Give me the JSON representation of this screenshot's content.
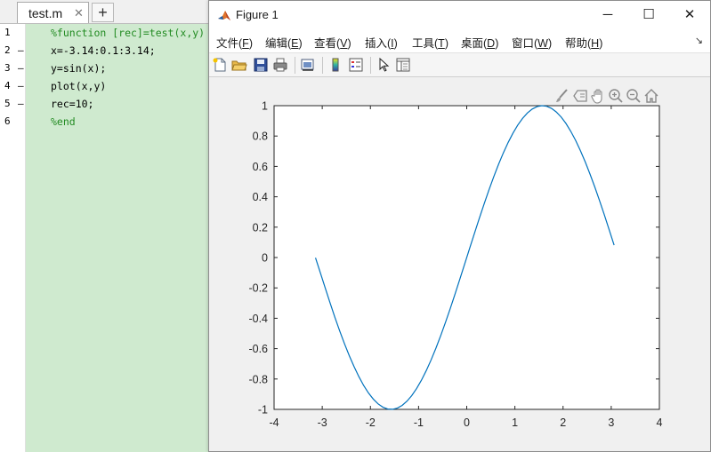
{
  "editor": {
    "tab_label": "test.m",
    "tab_close": "✕",
    "tab_add": "+",
    "lines": [
      {
        "num": "1",
        "marker": "",
        "text": "%function [rec]=test(x,y)",
        "comment": true
      },
      {
        "num": "2",
        "marker": "–",
        "text": "x=-3.14:0.1:3.14;",
        "comment": false
      },
      {
        "num": "3",
        "marker": "–",
        "text": "y=sin(x);",
        "comment": false
      },
      {
        "num": "4",
        "marker": "–",
        "text": "plot(x,y)",
        "comment": false
      },
      {
        "num": "5",
        "marker": "–",
        "text": "rec=10;",
        "comment": false
      },
      {
        "num": "6",
        "marker": "",
        "text": "%end",
        "comment": true
      }
    ]
  },
  "figure": {
    "title": "Figure 1",
    "window_buttons": {
      "minimize": "─",
      "maximize": "☐",
      "close": "✕"
    },
    "menu": [
      {
        "label": "文件(",
        "key": "F"
      },
      {
        "label": "编辑(",
        "key": "E"
      },
      {
        "label": "查看(",
        "key": "V"
      },
      {
        "label": "插入(",
        "key": "I"
      },
      {
        "label": "工具(",
        "key": "T"
      },
      {
        "label": "桌面(",
        "key": "D"
      },
      {
        "label": "窗口(",
        "key": "W"
      },
      {
        "label": "帮助(",
        "key": "H"
      }
    ],
    "menu_overflow": "↘",
    "toolbar_icons": [
      "new-figure-icon",
      "open-file-icon",
      "save-icon",
      "print-icon",
      "link-plot-icon",
      "insert-colorbar-icon",
      "insert-legend-icon",
      "edit-plot-icon",
      "property-inspector-icon"
    ],
    "axes_toolbar_icons": [
      "brush-icon",
      "data-tips-icon",
      "pan-icon",
      "zoom-in-icon",
      "zoom-out-icon",
      "home-icon"
    ]
  },
  "colors": {
    "line": "#0072bd",
    "code_bg": "#cfeacf",
    "comment": "#228b22"
  },
  "chart_data": {
    "type": "line",
    "xlim": [
      -4,
      4
    ],
    "ylim": [
      -1,
      1
    ],
    "xticks": [
      "-4",
      "-3",
      "-2",
      "-1",
      "0",
      "1",
      "2",
      "3",
      "4"
    ],
    "yticks": [
      "1",
      "0.8",
      "0.6",
      "0.4",
      "0.2",
      "0",
      "-0.2",
      "-0.4",
      "-0.6",
      "-0.8",
      "-1"
    ],
    "grid": false,
    "series": [
      {
        "x": [
          -3.14,
          -3.04,
          -2.94,
          -2.84,
          -2.74,
          -2.64,
          -2.54,
          -2.44,
          -2.34,
          -2.24,
          -2.14,
          -2.04,
          -1.94,
          -1.84,
          -1.74,
          -1.64,
          -1.54,
          -1.44,
          -1.34,
          -1.24,
          -1.14,
          -1.04,
          -0.94,
          -0.84,
          -0.74,
          -0.64,
          -0.54,
          -0.44,
          -0.34,
          -0.24,
          -0.14,
          -0.04,
          0.06,
          0.16,
          0.26,
          0.36,
          0.46,
          0.56,
          0.66,
          0.76,
          0.86,
          0.96,
          1.06,
          1.16,
          1.26,
          1.36,
          1.46,
          1.56,
          1.66,
          1.76,
          1.86,
          1.96,
          2.06,
          2.16,
          2.26,
          2.36,
          2.46,
          2.56,
          2.66,
          2.76,
          2.86,
          2.96,
          3.06
        ],
        "y": [
          -0.0016,
          -0.0998,
          -0.1987,
          -0.2963,
          -0.3914,
          -0.4812,
          -0.5662,
          -0.6454,
          -0.7178,
          -0.7841,
          -0.8427,
          -0.8921,
          -0.9323,
          -0.9639,
          -0.9857,
          -0.9977,
          -0.9995,
          -0.9915,
          -0.9735,
          -0.9458,
          -0.9086,
          -0.8624,
          -0.8076,
          -0.7446,
          -0.6743,
          -0.5972,
          -0.5141,
          -0.4259,
          -0.3335,
          -0.2377,
          -0.1395,
          -0.04,
          0.06,
          0.1593,
          0.2571,
          0.3523,
          0.4439,
          0.5312,
          0.6131,
          0.6889,
          0.7578,
          0.8192,
          0.8724,
          0.9168,
          0.9521,
          0.9779,
          0.9939,
          0.9999,
          0.9959,
          0.9821,
          0.9585,
          0.9254,
          0.8829,
          0.8311,
          0.7718,
          0.7042,
          0.63,
          0.5491,
          0.4634,
          0.3725,
          0.2779,
          0.18,
          0.0815
        ]
      }
    ]
  }
}
